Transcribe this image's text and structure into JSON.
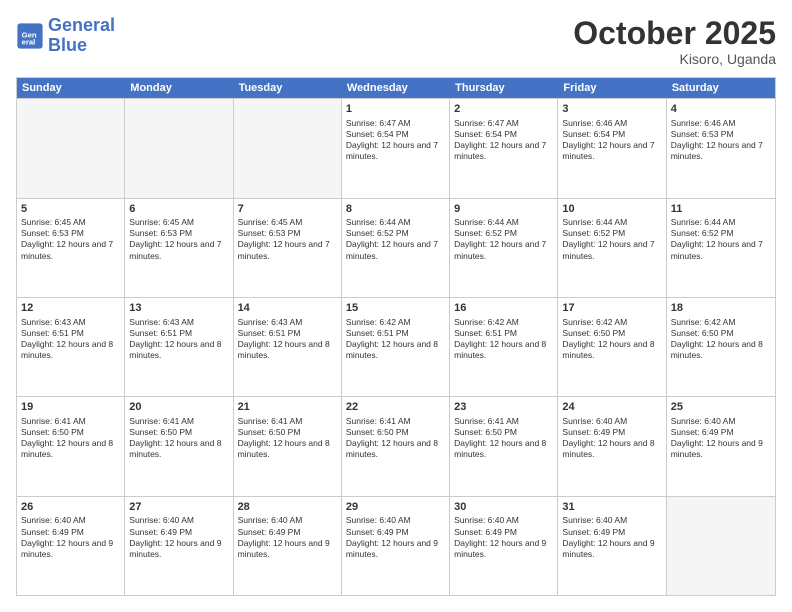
{
  "header": {
    "logo_general": "General",
    "logo_blue": "Blue",
    "month_title": "October 2025",
    "location": "Kisoro, Uganda"
  },
  "weekdays": [
    "Sunday",
    "Monday",
    "Tuesday",
    "Wednesday",
    "Thursday",
    "Friday",
    "Saturday"
  ],
  "rows": [
    [
      {
        "day": "",
        "empty": true
      },
      {
        "day": "",
        "empty": true
      },
      {
        "day": "",
        "empty": true
      },
      {
        "day": "1",
        "sunrise": "6:47 AM",
        "sunset": "6:54 PM",
        "daylight": "12 hours and 7 minutes."
      },
      {
        "day": "2",
        "sunrise": "6:47 AM",
        "sunset": "6:54 PM",
        "daylight": "12 hours and 7 minutes."
      },
      {
        "day": "3",
        "sunrise": "6:46 AM",
        "sunset": "6:54 PM",
        "daylight": "12 hours and 7 minutes."
      },
      {
        "day": "4",
        "sunrise": "6:46 AM",
        "sunset": "6:53 PM",
        "daylight": "12 hours and 7 minutes."
      }
    ],
    [
      {
        "day": "5",
        "sunrise": "6:45 AM",
        "sunset": "6:53 PM",
        "daylight": "12 hours and 7 minutes."
      },
      {
        "day": "6",
        "sunrise": "6:45 AM",
        "sunset": "6:53 PM",
        "daylight": "12 hours and 7 minutes."
      },
      {
        "day": "7",
        "sunrise": "6:45 AM",
        "sunset": "6:53 PM",
        "daylight": "12 hours and 7 minutes."
      },
      {
        "day": "8",
        "sunrise": "6:44 AM",
        "sunset": "6:52 PM",
        "daylight": "12 hours and 7 minutes."
      },
      {
        "day": "9",
        "sunrise": "6:44 AM",
        "sunset": "6:52 PM",
        "daylight": "12 hours and 7 minutes."
      },
      {
        "day": "10",
        "sunrise": "6:44 AM",
        "sunset": "6:52 PM",
        "daylight": "12 hours and 7 minutes."
      },
      {
        "day": "11",
        "sunrise": "6:44 AM",
        "sunset": "6:52 PM",
        "daylight": "12 hours and 7 minutes."
      }
    ],
    [
      {
        "day": "12",
        "sunrise": "6:43 AM",
        "sunset": "6:51 PM",
        "daylight": "12 hours and 8 minutes."
      },
      {
        "day": "13",
        "sunrise": "6:43 AM",
        "sunset": "6:51 PM",
        "daylight": "12 hours and 8 minutes."
      },
      {
        "day": "14",
        "sunrise": "6:43 AM",
        "sunset": "6:51 PM",
        "daylight": "12 hours and 8 minutes."
      },
      {
        "day": "15",
        "sunrise": "6:42 AM",
        "sunset": "6:51 PM",
        "daylight": "12 hours and 8 minutes."
      },
      {
        "day": "16",
        "sunrise": "6:42 AM",
        "sunset": "6:51 PM",
        "daylight": "12 hours and 8 minutes."
      },
      {
        "day": "17",
        "sunrise": "6:42 AM",
        "sunset": "6:50 PM",
        "daylight": "12 hours and 8 minutes."
      },
      {
        "day": "18",
        "sunrise": "6:42 AM",
        "sunset": "6:50 PM",
        "daylight": "12 hours and 8 minutes."
      }
    ],
    [
      {
        "day": "19",
        "sunrise": "6:41 AM",
        "sunset": "6:50 PM",
        "daylight": "12 hours and 8 minutes."
      },
      {
        "day": "20",
        "sunrise": "6:41 AM",
        "sunset": "6:50 PM",
        "daylight": "12 hours and 8 minutes."
      },
      {
        "day": "21",
        "sunrise": "6:41 AM",
        "sunset": "6:50 PM",
        "daylight": "12 hours and 8 minutes."
      },
      {
        "day": "22",
        "sunrise": "6:41 AM",
        "sunset": "6:50 PM",
        "daylight": "12 hours and 8 minutes."
      },
      {
        "day": "23",
        "sunrise": "6:41 AM",
        "sunset": "6:50 PM",
        "daylight": "12 hours and 8 minutes."
      },
      {
        "day": "24",
        "sunrise": "6:40 AM",
        "sunset": "6:49 PM",
        "daylight": "12 hours and 8 minutes."
      },
      {
        "day": "25",
        "sunrise": "6:40 AM",
        "sunset": "6:49 PM",
        "daylight": "12 hours and 9 minutes."
      }
    ],
    [
      {
        "day": "26",
        "sunrise": "6:40 AM",
        "sunset": "6:49 PM",
        "daylight": "12 hours and 9 minutes."
      },
      {
        "day": "27",
        "sunrise": "6:40 AM",
        "sunset": "6:49 PM",
        "daylight": "12 hours and 9 minutes."
      },
      {
        "day": "28",
        "sunrise": "6:40 AM",
        "sunset": "6:49 PM",
        "daylight": "12 hours and 9 minutes."
      },
      {
        "day": "29",
        "sunrise": "6:40 AM",
        "sunset": "6:49 PM",
        "daylight": "12 hours and 9 minutes."
      },
      {
        "day": "30",
        "sunrise": "6:40 AM",
        "sunset": "6:49 PM",
        "daylight": "12 hours and 9 minutes."
      },
      {
        "day": "31",
        "sunrise": "6:40 AM",
        "sunset": "6:49 PM",
        "daylight": "12 hours and 9 minutes."
      },
      {
        "day": "",
        "empty": true
      }
    ]
  ]
}
